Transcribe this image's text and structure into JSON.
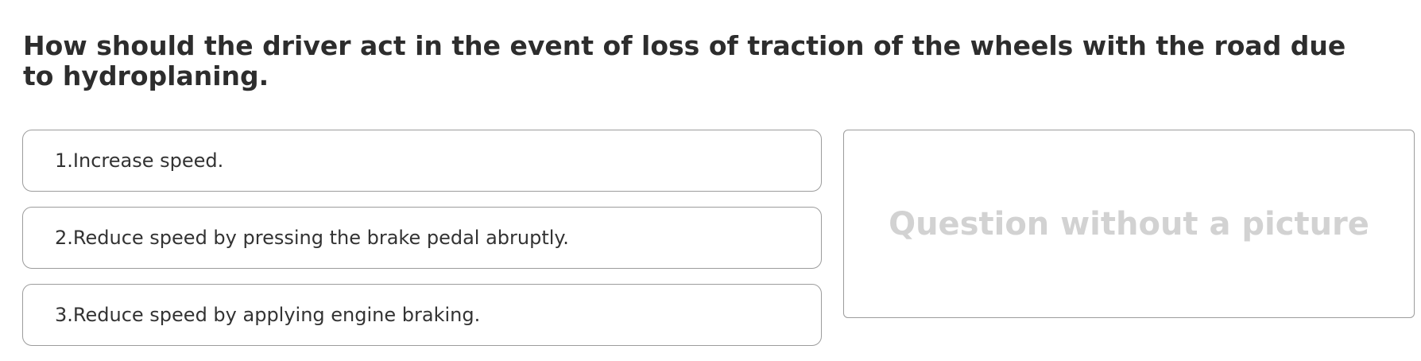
{
  "question": {
    "text": "How should the driver act in the event of loss of traction of the wheels with the road due to hydroplaning."
  },
  "answers": [
    {
      "label": "1.Increase speed."
    },
    {
      "label": "2.Reduce speed by pressing the brake pedal abruptly."
    },
    {
      "label": "3.Reduce speed by applying engine braking."
    }
  ],
  "picture": {
    "placeholder_text": "Question without a picture"
  }
}
